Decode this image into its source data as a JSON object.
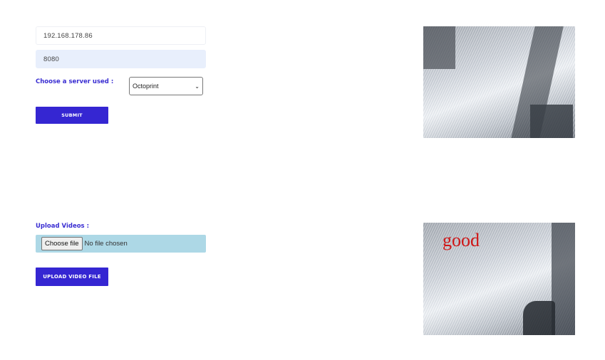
{
  "connection_form": {
    "ip_value": "192.168.178.86",
    "port_value": "8080",
    "server_label": "Choose a server used :",
    "server_selected": "Octoprint",
    "submit_label": "SUBMIT"
  },
  "upload_form": {
    "label": "Upload Videos :",
    "choose_file_label": "Choose file",
    "file_status": "No file chosen",
    "upload_label": "UPLOAD VIDEO FILE"
  },
  "camera_feeds": {
    "detection_text": "good"
  },
  "icons": {
    "select_arrow": "chevron-down-icon"
  },
  "colors": {
    "accent": "#3526d2",
    "file_input_bg": "#add8e6",
    "port_field_bg": "#e8effc",
    "detection_text": "#d01515"
  }
}
